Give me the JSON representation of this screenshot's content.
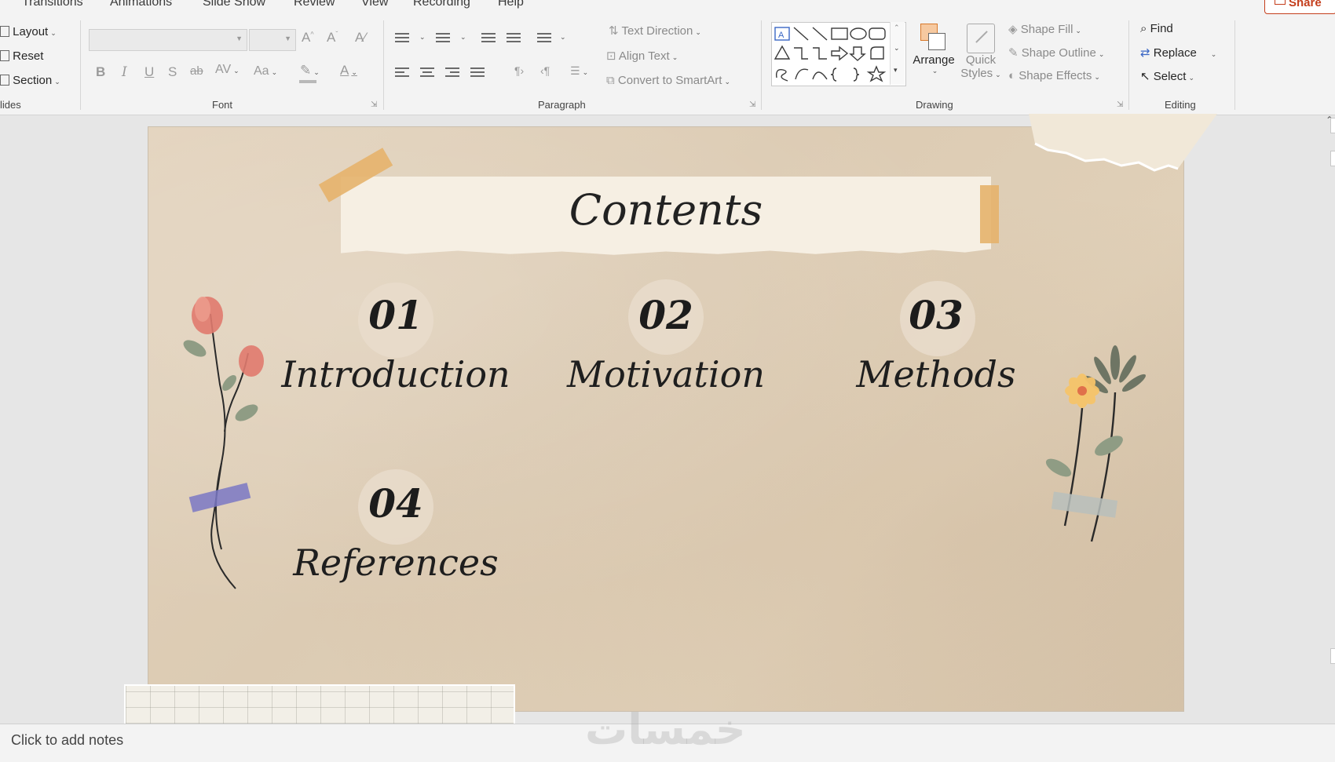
{
  "tabs": [
    "Transitions",
    "Animations",
    "Slide Show",
    "Review",
    "View",
    "Recording",
    "Help"
  ],
  "share_label": "Share",
  "slides_group": {
    "layout": "Layout",
    "reset": "Reset",
    "section": "Section",
    "group_label": "lides"
  },
  "font_group": {
    "group_label": "Font",
    "font_name": "",
    "font_size": "",
    "bold": "B",
    "italic": "I",
    "underline": "U",
    "shadow": "S",
    "strike": "ab",
    "spacing": "AV",
    "change_case": "Aa",
    "font_color": "A"
  },
  "paragraph_group": {
    "group_label": "Paragraph",
    "text_direction": "Text Direction",
    "align_text": "Align Text",
    "convert_smartart": "Convert to SmartArt"
  },
  "drawing_group": {
    "group_label": "Drawing",
    "arrange": "Arrange",
    "quick_styles_1": "Quick",
    "quick_styles_2": "Styles",
    "shape_fill": "Shape Fill",
    "shape_outline": "Shape Outline",
    "shape_effects": "Shape Effects"
  },
  "editing_group": {
    "group_label": "Editing",
    "find": "Find",
    "replace": "Replace",
    "select": "Select"
  },
  "slide": {
    "title": "Contents",
    "items": [
      {
        "num": "01",
        "label": "Introduction"
      },
      {
        "num": "02",
        "label": "Motivation"
      },
      {
        "num": "03",
        "label": "Methods"
      },
      {
        "num": "04",
        "label": "References"
      }
    ]
  },
  "notes_placeholder": "Click to add notes",
  "watermark": "خمسات",
  "colors": {
    "accent": "#c43e1c",
    "tape": "#e6b36b",
    "paper": "#e0d0b8"
  }
}
